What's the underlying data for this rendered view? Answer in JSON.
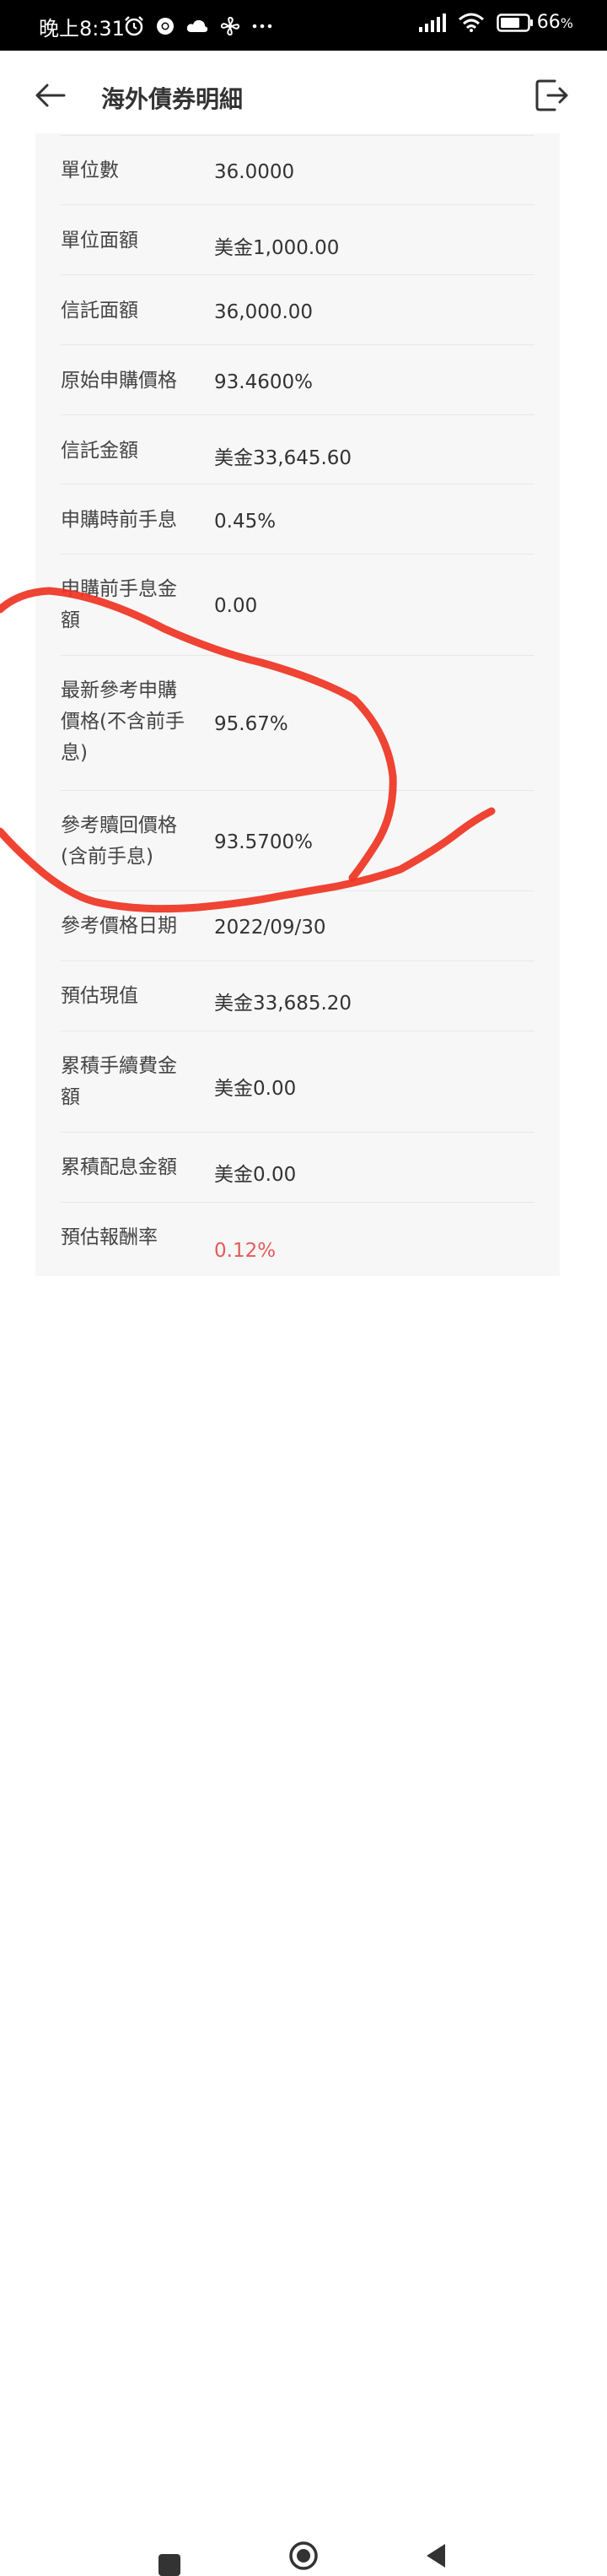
{
  "status_bar": {
    "time": "晚上8:31",
    "battery": "66",
    "battery_unit": "%"
  },
  "header": {
    "title": "海外債券明細"
  },
  "details": [
    {
      "label": "單位數",
      "value": "36.0000"
    },
    {
      "label": "單位面額",
      "value": "美金1,000.00"
    },
    {
      "label": "信託面額",
      "value": "36,000.00"
    },
    {
      "label": "原始申購價格",
      "value": "93.4600%"
    },
    {
      "label": "信託金額",
      "value": "美金33,645.60"
    },
    {
      "label": "申購時前手息",
      "value": "0.45%"
    },
    {
      "label": "申購前手息金額",
      "value": "0.00"
    },
    {
      "label": "最新參考申購價格(不含前手息)",
      "value": "95.67%"
    },
    {
      "label": "參考贖回價格(含前手息)",
      "value": "93.5700%"
    },
    {
      "label": "參考價格日期",
      "value": "2022/09/30"
    },
    {
      "label": "預估現值",
      "value": "美金33,685.20"
    },
    {
      "label": "累積手續費金額",
      "value": "美金0.00"
    },
    {
      "label": "累積配息金額",
      "value": "美金0.00"
    },
    {
      "label": "預估報酬率",
      "value": "0.12%"
    }
  ],
  "colors": {
    "negative_value": "#e45a5a",
    "annotation": "#ee3322"
  }
}
